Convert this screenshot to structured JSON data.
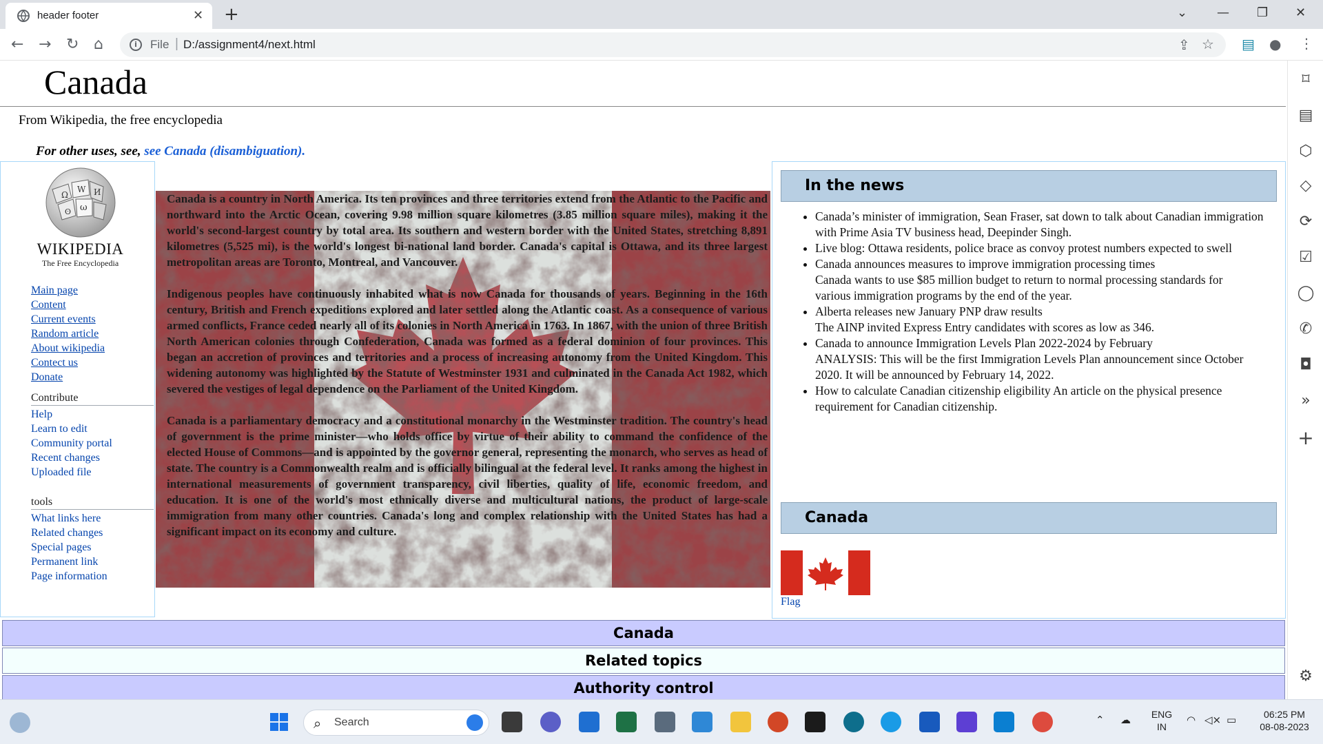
{
  "browser": {
    "tab_title": "header footer",
    "url_scheme": "File",
    "url": "D:/assignment4/next.html"
  },
  "page": {
    "title": "Canada",
    "subtitle": "From Wikipedia, the free encyclopedia",
    "hatnote_prefix": "For other uses, see,",
    "hatnote_link": "see Canada (disambiguation)."
  },
  "logo": {
    "wordmark": "WIKIPEDIA",
    "tagline": "The Free Encyclopedia"
  },
  "nav": {
    "main_links": [
      "Main page",
      "Content",
      "Current events",
      "Random article",
      "About wikipedia",
      "Contect us",
      "Donate"
    ],
    "contribute": {
      "heading": "Contribute",
      "links": [
        "Help",
        "Learn to edit",
        "Community portal",
        "Recent changes",
        "Uploaded file"
      ]
    },
    "tools": {
      "heading": "tools",
      "links": [
        "What links here",
        "Related changes",
        "Special pages",
        "Permanent link",
        "Page information"
      ]
    }
  },
  "content": {
    "paragraphs": [
      "Canada is a country in North America. Its ten provinces and three territories extend from the Atlantic to the Pacific and northward into the Arctic Ocean, covering 9.98 million square kilometres (3.85 million square miles), making it the world's second-largest country by total area. Its southern and western border with the United States, stretching 8,891 kilometres (5,525 mi), is the world's longest bi-national land border. Canada's capital is Ottawa, and its three largest metropolitan areas are Toronto, Montreal, and Vancouver.",
      "Indigenous peoples have continuously inhabited what is now Canada for thousands of years. Beginning in the 16th century, British and French expeditions explored and later settled along the Atlantic coast. As a consequence of various armed conflicts, France ceded nearly all of its colonies in North America in 1763. In 1867, with the union of three British North American colonies through Confederation, Canada was formed as a federal dominion of four provinces. This began an accretion of provinces and territories and a process of increasing autonomy from the United Kingdom. This widening autonomy was highlighted by the Statute of Westminster 1931 and culminated in the Canada Act 1982, which severed the vestiges of legal dependence on the Parliament of the United Kingdom.",
      "Canada is a parliamentary democracy and a constitutional monarchy in the Westminster tradition. The country's head of government is the prime minister—who holds office by virtue of their ability to command the confidence of the elected House of Commons—and is appointed by the governor general, representing the monarch, who serves as head of state. The country is a Commonwealth realm and is officially bilingual at the federal level. It ranks among the highest in international measurements of government transparency, civil liberties, quality of life, economic freedom, and education. It is one of the world's most ethnically diverse and multicultural nations, the product of large-scale immigration from many other countries. Canada's long and complex relationship with the United States has had a significant impact on its economy and culture."
    ]
  },
  "news": {
    "heading": "In the news",
    "items": [
      [
        "Canada’s minister of immigration, Sean Fraser, sat down to talk about Canadian immigration with Prime Asia TV business head, Deepinder Singh."
      ],
      [
        "Live blog: Ottawa residents, police brace as convoy protest numbers expected to swell"
      ],
      [
        "Canada announces measures to improve immigration processing times",
        "Canada wants to use $85 million budget to return to normal processing standards for",
        "various immigration programs by the end of the year."
      ],
      [
        "Alberta releases new January PNP draw results",
        "The AINP invited Express Entry candidates with scores as low as 346."
      ],
      [
        "Canada to announce Immigration Levels Plan 2022-2024 by February",
        "ANALYSIS: This will be the first Immigration Levels Plan announcement since October",
        "2020. It will be announced by February 14, 2022."
      ],
      [
        "How to calculate Canadian citizenship eligibility An article on the physical presence requirement for Canadian citizenship."
      ]
    ]
  },
  "canada_box": {
    "heading": "Canada",
    "flag_caption": "Flag"
  },
  "footer": {
    "bars": [
      "Canada",
      "Related topics",
      "Authority control"
    ]
  },
  "taskbar": {
    "search_label": "Search",
    "lang_line1": "ENG",
    "lang_line2": "IN",
    "time": "06:25 PM",
    "date": "08-08-2023"
  },
  "colors": {
    "link": "#0645ad",
    "box_border": "#a7d7f9",
    "box_heading_bg": "#b8cfe3",
    "footer_purple": "#c9cbff",
    "footer_pale": "#f3fffe",
    "flag_red": "#d52b1e"
  },
  "icons": {
    "tab_favicon": "globe-icon",
    "left_nav": [
      "back-arrow-icon",
      "forward-arrow-icon",
      "reload-icon",
      "home-icon"
    ],
    "sidebar": [
      "bookmark-icon",
      "reading-list-icon",
      "cube-icon",
      "tag-icon",
      "sync-icon",
      "checklist-icon",
      "messenger-icon",
      "whatsapp-icon",
      "instagram-icon",
      "chevron-panel-icon",
      "plus-icon",
      "settings-gear-icon"
    ]
  }
}
